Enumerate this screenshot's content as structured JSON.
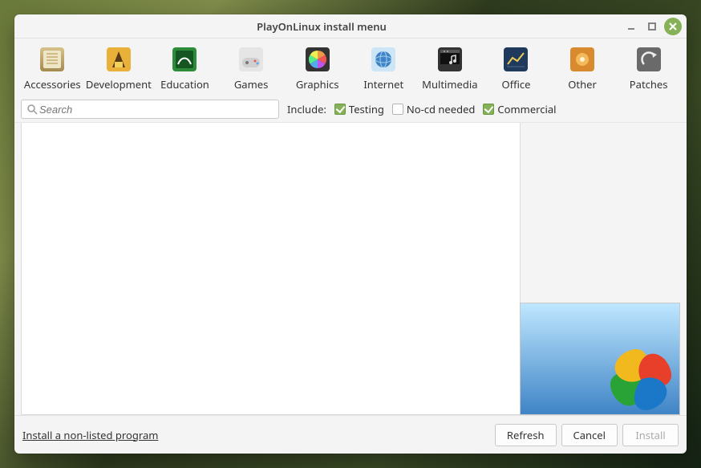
{
  "window": {
    "title": "PlayOnLinux install menu"
  },
  "categories": [
    {
      "id": "accessories",
      "label": "Accessories"
    },
    {
      "id": "development",
      "label": "Development"
    },
    {
      "id": "education",
      "label": "Education"
    },
    {
      "id": "games",
      "label": "Games"
    },
    {
      "id": "graphics",
      "label": "Graphics"
    },
    {
      "id": "internet",
      "label": "Internet"
    },
    {
      "id": "multimedia",
      "label": "Multimedia"
    },
    {
      "id": "office",
      "label": "Office"
    },
    {
      "id": "other",
      "label": "Other"
    },
    {
      "id": "patches",
      "label": "Patches"
    }
  ],
  "search": {
    "placeholder": "Search"
  },
  "include": {
    "label": "Include:",
    "options": [
      {
        "id": "testing",
        "label": "Testing",
        "checked": true
      },
      {
        "id": "nocd",
        "label": "No-cd needed",
        "checked": false
      },
      {
        "id": "commercial",
        "label": "Commercial",
        "checked": true
      }
    ]
  },
  "footer": {
    "install_nonlisted": "Install a non-listed program",
    "refresh": "Refresh",
    "cancel": "Cancel",
    "install": "Install"
  }
}
